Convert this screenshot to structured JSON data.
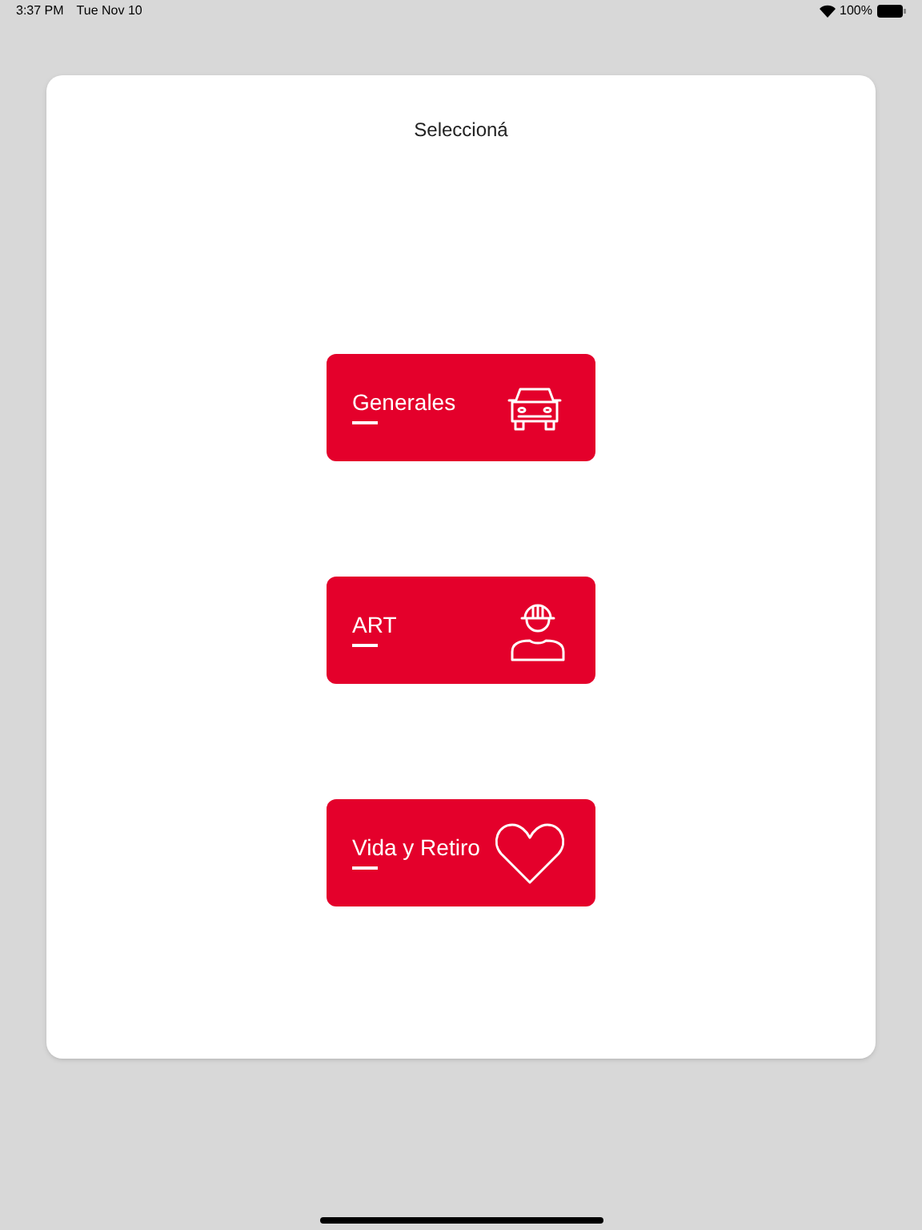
{
  "status_bar": {
    "time": "3:37 PM",
    "date": "Tue Nov 10",
    "battery": "100%"
  },
  "title": "Seleccioná",
  "options": [
    {
      "label": "Generales",
      "kind": "car"
    },
    {
      "label": "ART",
      "kind": "worker"
    },
    {
      "label": "Vida y Retiro",
      "kind": "heart"
    }
  ]
}
